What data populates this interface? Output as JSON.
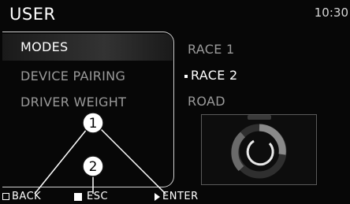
{
  "header": {
    "title": "USER",
    "time": "10:30"
  },
  "menu": {
    "items": [
      {
        "label": "MODES",
        "selected": true
      },
      {
        "label": "DEVICE PAIRING",
        "selected": false
      },
      {
        "label": "DRIVER WEIGHT",
        "selected": false
      }
    ]
  },
  "submenu": {
    "items": [
      {
        "label": "RACE 1",
        "active": false
      },
      {
        "label": "RACE 2",
        "active": true
      },
      {
        "label": "ROAD",
        "active": false
      }
    ]
  },
  "footer": {
    "back_label": "BACK",
    "esc_label": "ESC",
    "enter_label": "ENTER"
  },
  "callouts": {
    "one": "1",
    "two": "2"
  },
  "colors": {
    "background": "#070707",
    "text": "#ffffff",
    "inactive_text": "#9a9a9a",
    "frame": "#cfcfcf"
  },
  "icons": {
    "back": "hollow-square-icon",
    "esc": "filled-square-icon",
    "enter": "triangle-icon",
    "mode_preview": "ring-gauge-icon"
  }
}
